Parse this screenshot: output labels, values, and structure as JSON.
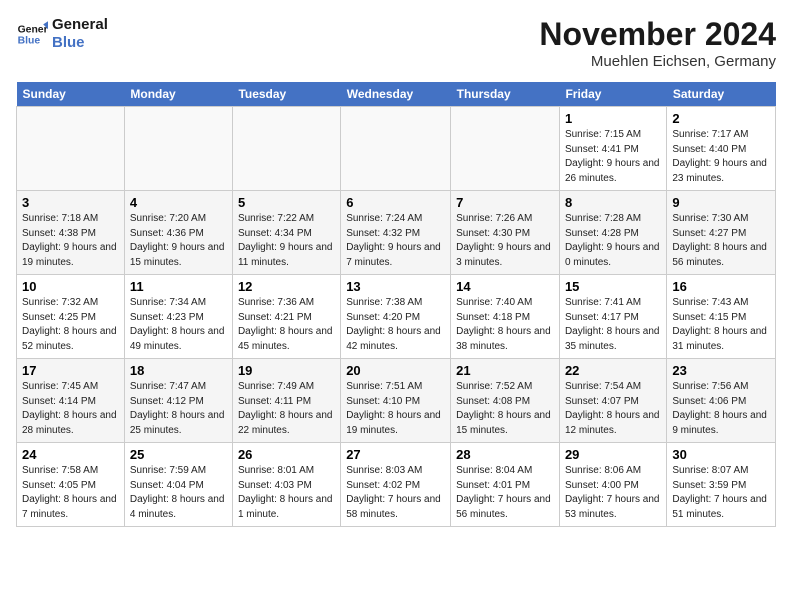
{
  "header": {
    "logo_line1": "General",
    "logo_line2": "Blue",
    "month": "November 2024",
    "location": "Muehlen Eichsen, Germany"
  },
  "days_of_week": [
    "Sunday",
    "Monday",
    "Tuesday",
    "Wednesday",
    "Thursday",
    "Friday",
    "Saturday"
  ],
  "weeks": [
    [
      {
        "day": "",
        "info": ""
      },
      {
        "day": "",
        "info": ""
      },
      {
        "day": "",
        "info": ""
      },
      {
        "day": "",
        "info": ""
      },
      {
        "day": "",
        "info": ""
      },
      {
        "day": "1",
        "info": "Sunrise: 7:15 AM\nSunset: 4:41 PM\nDaylight: 9 hours and 26 minutes."
      },
      {
        "day": "2",
        "info": "Sunrise: 7:17 AM\nSunset: 4:40 PM\nDaylight: 9 hours and 23 minutes."
      }
    ],
    [
      {
        "day": "3",
        "info": "Sunrise: 7:18 AM\nSunset: 4:38 PM\nDaylight: 9 hours and 19 minutes."
      },
      {
        "day": "4",
        "info": "Sunrise: 7:20 AM\nSunset: 4:36 PM\nDaylight: 9 hours and 15 minutes."
      },
      {
        "day": "5",
        "info": "Sunrise: 7:22 AM\nSunset: 4:34 PM\nDaylight: 9 hours and 11 minutes."
      },
      {
        "day": "6",
        "info": "Sunrise: 7:24 AM\nSunset: 4:32 PM\nDaylight: 9 hours and 7 minutes."
      },
      {
        "day": "7",
        "info": "Sunrise: 7:26 AM\nSunset: 4:30 PM\nDaylight: 9 hours and 3 minutes."
      },
      {
        "day": "8",
        "info": "Sunrise: 7:28 AM\nSunset: 4:28 PM\nDaylight: 9 hours and 0 minutes."
      },
      {
        "day": "9",
        "info": "Sunrise: 7:30 AM\nSunset: 4:27 PM\nDaylight: 8 hours and 56 minutes."
      }
    ],
    [
      {
        "day": "10",
        "info": "Sunrise: 7:32 AM\nSunset: 4:25 PM\nDaylight: 8 hours and 52 minutes."
      },
      {
        "day": "11",
        "info": "Sunrise: 7:34 AM\nSunset: 4:23 PM\nDaylight: 8 hours and 49 minutes."
      },
      {
        "day": "12",
        "info": "Sunrise: 7:36 AM\nSunset: 4:21 PM\nDaylight: 8 hours and 45 minutes."
      },
      {
        "day": "13",
        "info": "Sunrise: 7:38 AM\nSunset: 4:20 PM\nDaylight: 8 hours and 42 minutes."
      },
      {
        "day": "14",
        "info": "Sunrise: 7:40 AM\nSunset: 4:18 PM\nDaylight: 8 hours and 38 minutes."
      },
      {
        "day": "15",
        "info": "Sunrise: 7:41 AM\nSunset: 4:17 PM\nDaylight: 8 hours and 35 minutes."
      },
      {
        "day": "16",
        "info": "Sunrise: 7:43 AM\nSunset: 4:15 PM\nDaylight: 8 hours and 31 minutes."
      }
    ],
    [
      {
        "day": "17",
        "info": "Sunrise: 7:45 AM\nSunset: 4:14 PM\nDaylight: 8 hours and 28 minutes."
      },
      {
        "day": "18",
        "info": "Sunrise: 7:47 AM\nSunset: 4:12 PM\nDaylight: 8 hours and 25 minutes."
      },
      {
        "day": "19",
        "info": "Sunrise: 7:49 AM\nSunset: 4:11 PM\nDaylight: 8 hours and 22 minutes."
      },
      {
        "day": "20",
        "info": "Sunrise: 7:51 AM\nSunset: 4:10 PM\nDaylight: 8 hours and 19 minutes."
      },
      {
        "day": "21",
        "info": "Sunrise: 7:52 AM\nSunset: 4:08 PM\nDaylight: 8 hours and 15 minutes."
      },
      {
        "day": "22",
        "info": "Sunrise: 7:54 AM\nSunset: 4:07 PM\nDaylight: 8 hours and 12 minutes."
      },
      {
        "day": "23",
        "info": "Sunrise: 7:56 AM\nSunset: 4:06 PM\nDaylight: 8 hours and 9 minutes."
      }
    ],
    [
      {
        "day": "24",
        "info": "Sunrise: 7:58 AM\nSunset: 4:05 PM\nDaylight: 8 hours and 7 minutes."
      },
      {
        "day": "25",
        "info": "Sunrise: 7:59 AM\nSunset: 4:04 PM\nDaylight: 8 hours and 4 minutes."
      },
      {
        "day": "26",
        "info": "Sunrise: 8:01 AM\nSunset: 4:03 PM\nDaylight: 8 hours and 1 minute."
      },
      {
        "day": "27",
        "info": "Sunrise: 8:03 AM\nSunset: 4:02 PM\nDaylight: 7 hours and 58 minutes."
      },
      {
        "day": "28",
        "info": "Sunrise: 8:04 AM\nSunset: 4:01 PM\nDaylight: 7 hours and 56 minutes."
      },
      {
        "day": "29",
        "info": "Sunrise: 8:06 AM\nSunset: 4:00 PM\nDaylight: 7 hours and 53 minutes."
      },
      {
        "day": "30",
        "info": "Sunrise: 8:07 AM\nSunset: 3:59 PM\nDaylight: 7 hours and 51 minutes."
      }
    ]
  ]
}
